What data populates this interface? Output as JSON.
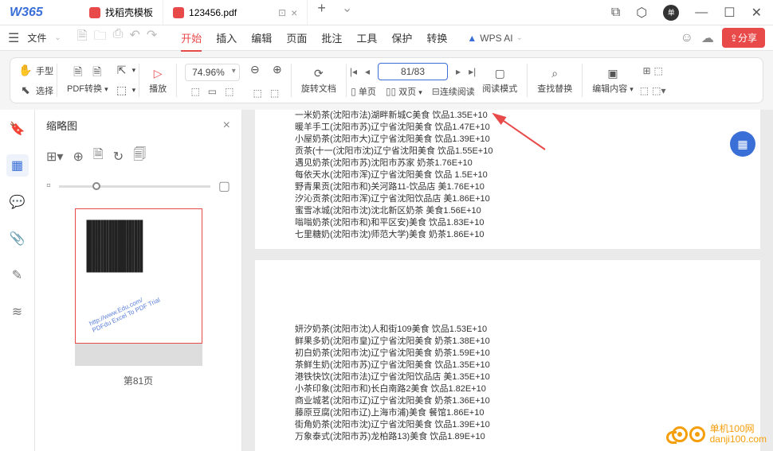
{
  "titlebar": {
    "logo": "W365",
    "tabs": [
      {
        "icon": "tab-icon-red",
        "label": "找稻壳模板",
        "has_close": false
      },
      {
        "icon": "tab-icon-red",
        "label": "123456.pdf",
        "has_close": true,
        "has_display": true,
        "active": true
      }
    ],
    "avatar": "单"
  },
  "menubar": {
    "file": "文件",
    "items": [
      "开始",
      "插入",
      "编辑",
      "页面",
      "批注",
      "工具",
      "保护",
      "转换"
    ],
    "active_index": 0,
    "wps_ai": "WPS AI",
    "share": "分享"
  },
  "toolbar": {
    "hand": "手型",
    "select": "选择",
    "pdf_convert": "PDF转换",
    "play": "播放",
    "zoom": "74.96%",
    "rotate": "旋转文档",
    "single_page": "单页",
    "double_page": "双页",
    "continuous": "连续阅读",
    "page_indicator": "81/83",
    "read_mode": "阅读模式",
    "find_replace": "查找替换",
    "edit_content": "编辑内容"
  },
  "thumbnail": {
    "title": "缩略图",
    "page_label": "第81页",
    "watermark1": "http://www.Edu.com/",
    "watermark2": "PDFdu Excel To PDF Trial"
  },
  "content": {
    "page1_lines": [
      "一米奶茶(沈阳市法)湖畔新城C美食  饮品1.35E+10",
      "暖羊手工(沈阳市苏)辽宁省沈阳美食  饮品1.47E+10",
      "小屋奶茶(沈阳市大)辽宁省沈阳美食  饮品1.39E+10",
      "贡茶(十一(沈阳市沈)辽宁省沈阳美食  饮品1.55E+10",
      "遇见奶茶(沈阳市苏)沈阳市苏家  奶茶1.76E+10",
      "每依天水(沈阳市浑)辽宁省沈阳美食  饮品  1.5E+10",
      "野青果贡(沈阳市和)关河路11-饮品店  美1.76E+10",
      "汐沁贡茶(沈阳市浑)辽宁省沈阳饮品店  美1.86E+10",
      "蜜雪冰城(沈阳市沈)沈北新区奶茶  美食1.56E+10",
      "嗡嗡奶茶(沈阳市和)和平区安)美食  饮品1.83E+10",
      "七里糖奶(沈阳市沈)师范大学)美食  奶茶1.86E+10"
    ],
    "page2_lines": [
      "妍汐奶茶(沈阳市沈)人和街109美食  饮品1.53E+10",
      "鲜果多奶(沈阳市皇)辽宁省沈阳美食  奶茶1.38E+10",
      "初白奶茶(沈阳市沈)辽宁省沈阳美食  奶茶1.59E+10",
      "茶鲜生奶(沈阳市苏)辽宁省沈阳美食  饮品1.35E+10",
      "港铁快饮(沈阳市法)辽宁省沈阳饮品店  美1.35E+10",
      "小茶印象(沈阳市和)长白南路2美食  饮品1.82E+10",
      "商业城茗(沈阳市辽)辽宁省沈阳美食  奶茶1.36E+10",
      "藤原豆腐(沈阳市辽)上海市浦)美食  餐馆1.86E+10",
      "街角奶茶(沈阳市沈)辽宁省沈阳美食  饮品1.39E+10",
      "万象泰式(沈阳市苏)龙柏路13)美食  饮品1.89E+10"
    ]
  },
  "watermark": {
    "line1": "单机100网",
    "line2": "danji100.com"
  }
}
